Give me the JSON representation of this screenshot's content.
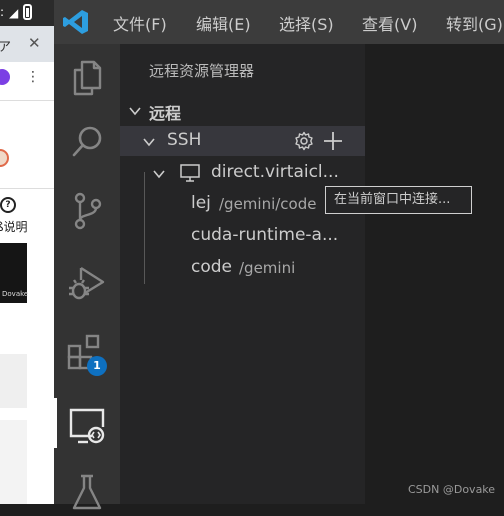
{
  "browser_strip": {
    "help_text": "ß说明",
    "thumbnail_caption": "Dovake"
  },
  "menu": {
    "items": [
      "文件(F)",
      "编辑(E)",
      "选择(S)",
      "查看(V)",
      "转到(G)"
    ]
  },
  "activity_bar": {
    "extensions_badge": "1",
    "icons": [
      "explorer-icon",
      "search-icon",
      "source-control-icon",
      "run-debug-icon",
      "extensions-icon",
      "remote-explorer-icon",
      "testing-icon"
    ]
  },
  "sidebar": {
    "title": "远程资源管理器",
    "section": "远程",
    "ssh_group": "SSH",
    "host": "direct.virtaicl...",
    "folders": [
      {
        "name": "lej",
        "path": "/gemini/code"
      },
      {
        "name": "cuda-runtime-a...",
        "path": ""
      },
      {
        "name": "code",
        "path": "/gemini"
      }
    ]
  },
  "tooltip": {
    "text": "在当前窗口中连接..."
  },
  "watermark": "CSDN @Dovake",
  "colors": {
    "titlebar": "#3c3c3c",
    "activity_bar": "#333333",
    "sidebar": "#252526",
    "editor": "#1e1e1e",
    "badge": "#0e70c0",
    "vscode_blue": "#2d9ee0"
  }
}
